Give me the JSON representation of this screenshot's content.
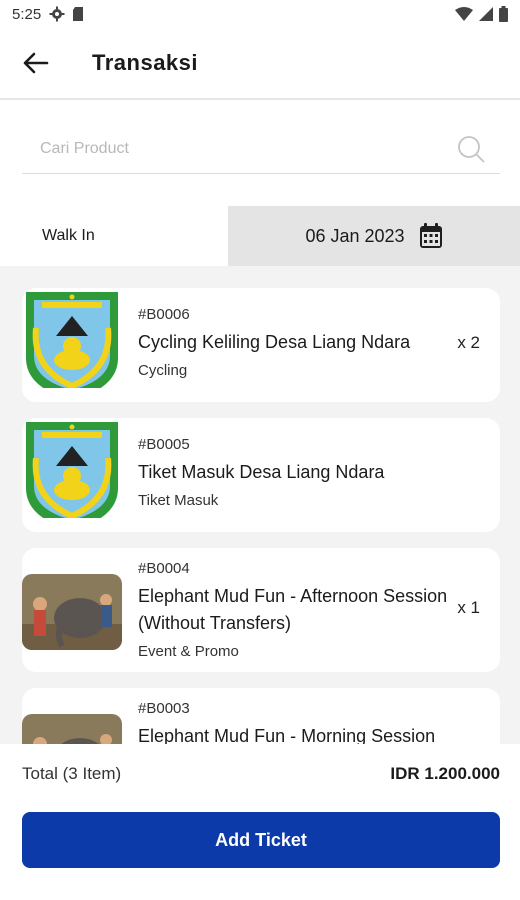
{
  "status_bar": {
    "time": "5:25"
  },
  "app_bar": {
    "title": "Transaksi"
  },
  "search": {
    "placeholder": "Cari Product"
  },
  "filter": {
    "walk_in_label": "Walk In",
    "date": "06 Jan 2023"
  },
  "items": [
    {
      "code": "#B0006",
      "name": "Cycling Keliling Desa Liang Ndara",
      "category": "Cycling",
      "qty": "x 2",
      "thumb": "regency-emblem"
    },
    {
      "code": "#B0005",
      "name": "Tiket Masuk Desa Liang Ndara",
      "category": "Tiket Masuk",
      "qty": "",
      "thumb": "regency-emblem"
    },
    {
      "code": "#B0004",
      "name": "Elephant Mud Fun - Afternoon Session (Without Transfers)",
      "category": "Event & Promo",
      "qty": "x 1",
      "thumb": "elephant-photo"
    },
    {
      "code": "#B0003",
      "name": "Elephant Mud Fun - Morning Session",
      "category": "",
      "qty": "",
      "thumb": "elephant-photo"
    }
  ],
  "footer": {
    "total_label": "Total (3 Item)",
    "total_value": "IDR 1.200.000",
    "add_button_label": "Add Ticket"
  },
  "colors": {
    "primary": "#0d3aa9",
    "date_bg": "#e4e4e4",
    "list_bg": "#f3f3f3"
  }
}
